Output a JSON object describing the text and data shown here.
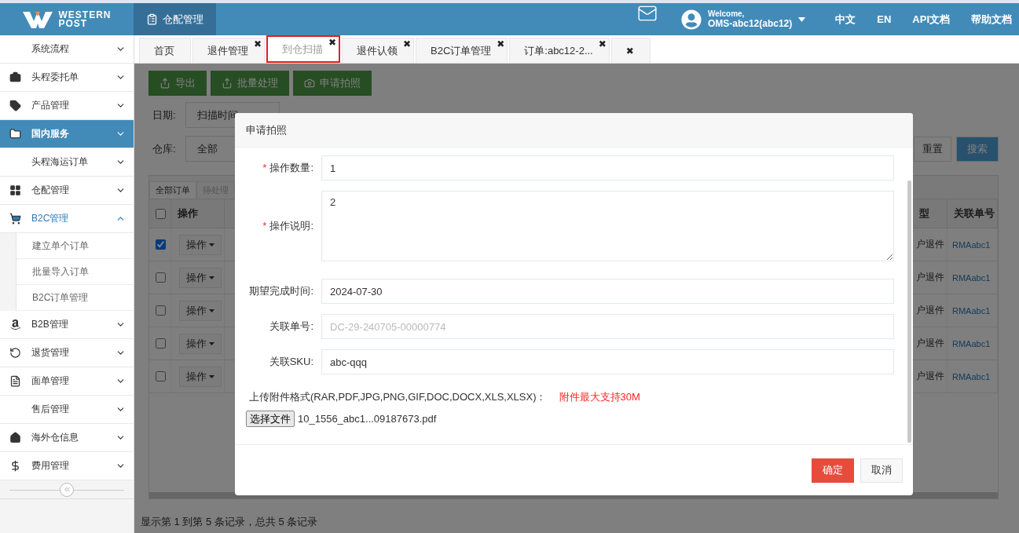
{
  "header": {
    "logo": {
      "line_1": "WESTERN",
      "line_2": "POST"
    },
    "module": {
      "label": "仓配管理",
      "selected": true
    },
    "welcome": "Welcome,",
    "user": "OMS-abc12(abc12)",
    "links": [
      "中文",
      "EN",
      "API文档",
      "帮助文档"
    ]
  },
  "sidebar": {
    "items": [
      {
        "label": "系统流程",
        "selected": false,
        "expanded": false
      },
      {
        "label": "头程委托单",
        "selected": false,
        "expanded": false
      },
      {
        "label": "产品管理",
        "selected": false,
        "expanded": false
      },
      {
        "label": "国内服务",
        "selected": true,
        "expanded": false
      },
      {
        "label": "头程海运订单",
        "selected": false,
        "expanded": false
      },
      {
        "label": "仓配管理",
        "selected": false,
        "expanded": false
      },
      {
        "label": "B2C管理",
        "selected": false,
        "expanded": true,
        "children": [
          {
            "label": "建立单个订单"
          },
          {
            "label": "批量导入订单"
          },
          {
            "label": "B2C订单管理"
          }
        ]
      },
      {
        "label": "B2B管理",
        "selected": false,
        "expanded": false
      },
      {
        "label": "退货管理",
        "selected": false,
        "expanded": false
      },
      {
        "label": "面单管理",
        "selected": false,
        "expanded": false
      },
      {
        "label": "售后管理",
        "selected": false,
        "expanded": false
      },
      {
        "label": "海外仓信息",
        "selected": false,
        "expanded": false
      },
      {
        "label": "费用管理",
        "selected": false,
        "expanded": false
      }
    ]
  },
  "tabs": [
    {
      "label": "首页",
      "selected": false,
      "highlighted": false
    },
    {
      "label": "退件管理",
      "close": "✖",
      "selected": false,
      "highlighted": false
    },
    {
      "label": "到仓扫描",
      "close": "✖",
      "selected": true,
      "highlighted": true
    },
    {
      "label": "退件认领",
      "close": "✖",
      "selected": false,
      "highlighted": false
    },
    {
      "label": "B2C订单管理",
      "close": "✖",
      "selected": false,
      "highlighted": false
    },
    {
      "label": "订单:abc12-2...",
      "close": "✖",
      "selected": false,
      "highlighted": false
    },
    {
      "close": "✖",
      "selected": false,
      "highlighted": false
    }
  ],
  "toolbar": [
    "导出",
    "批量处理",
    "申请拍照"
  ],
  "filters": {
    "date_label": "日期:",
    "date_value": "扫描时间",
    "warehouse_label": "仓库:",
    "warehouse_value": "全部",
    "reset": "重置",
    "search": "搜索"
  },
  "table": {
    "tabs": [
      {
        "label": "全部订单",
        "selected": true
      },
      {
        "label": "待处理",
        "selected": false
      }
    ],
    "all_selected": false,
    "columns": [
      "操作",
      "型",
      "关联单号"
    ],
    "rows": [
      {
        "selected": true,
        "action": "操作",
        "type": "户退件",
        "ref": "RMAabc1"
      },
      {
        "selected": false,
        "action": "操作",
        "type": "户退件",
        "ref": "RMAabc1"
      },
      {
        "selected": false,
        "action": "操作",
        "type": "户退件",
        "ref": "RMAabc1"
      },
      {
        "selected": false,
        "action": "操作",
        "type": "户退件",
        "ref": "RMAabc1"
      },
      {
        "selected": false,
        "action": "操作",
        "type": "户退件",
        "ref": "RMAabc1"
      }
    ]
  },
  "footer": "显示第 1 到第 5 条记录，总共 5 条记录",
  "modal": {
    "title": "申请拍照",
    "fields": [
      {
        "kind": "input",
        "mark": "*",
        "label": "操作数量:",
        "value": "1"
      },
      {
        "kind": "textarea",
        "mark": "*",
        "label": "操作说明:",
        "value": "2"
      },
      {
        "kind": "input",
        "label": "期望完成时间:",
        "value": "2024-07-30"
      },
      {
        "kind": "input",
        "label": "关联单号:",
        "placeholder": "DC-29-240705-00000774"
      },
      {
        "kind": "input",
        "label": "关联SKU:",
        "value": "abc-qqq"
      }
    ],
    "upload_label": "上传附件格式(RAR,PDF,JPG,PNG,GIF,DOC,DOCX,XLS,XLSX)：",
    "upload_note": "附件最大支持30M",
    "file_button": "选择文件",
    "file_name": "10_1556_abc1...09187673.pdf",
    "confirm": "确定",
    "cancel": "取消"
  }
}
